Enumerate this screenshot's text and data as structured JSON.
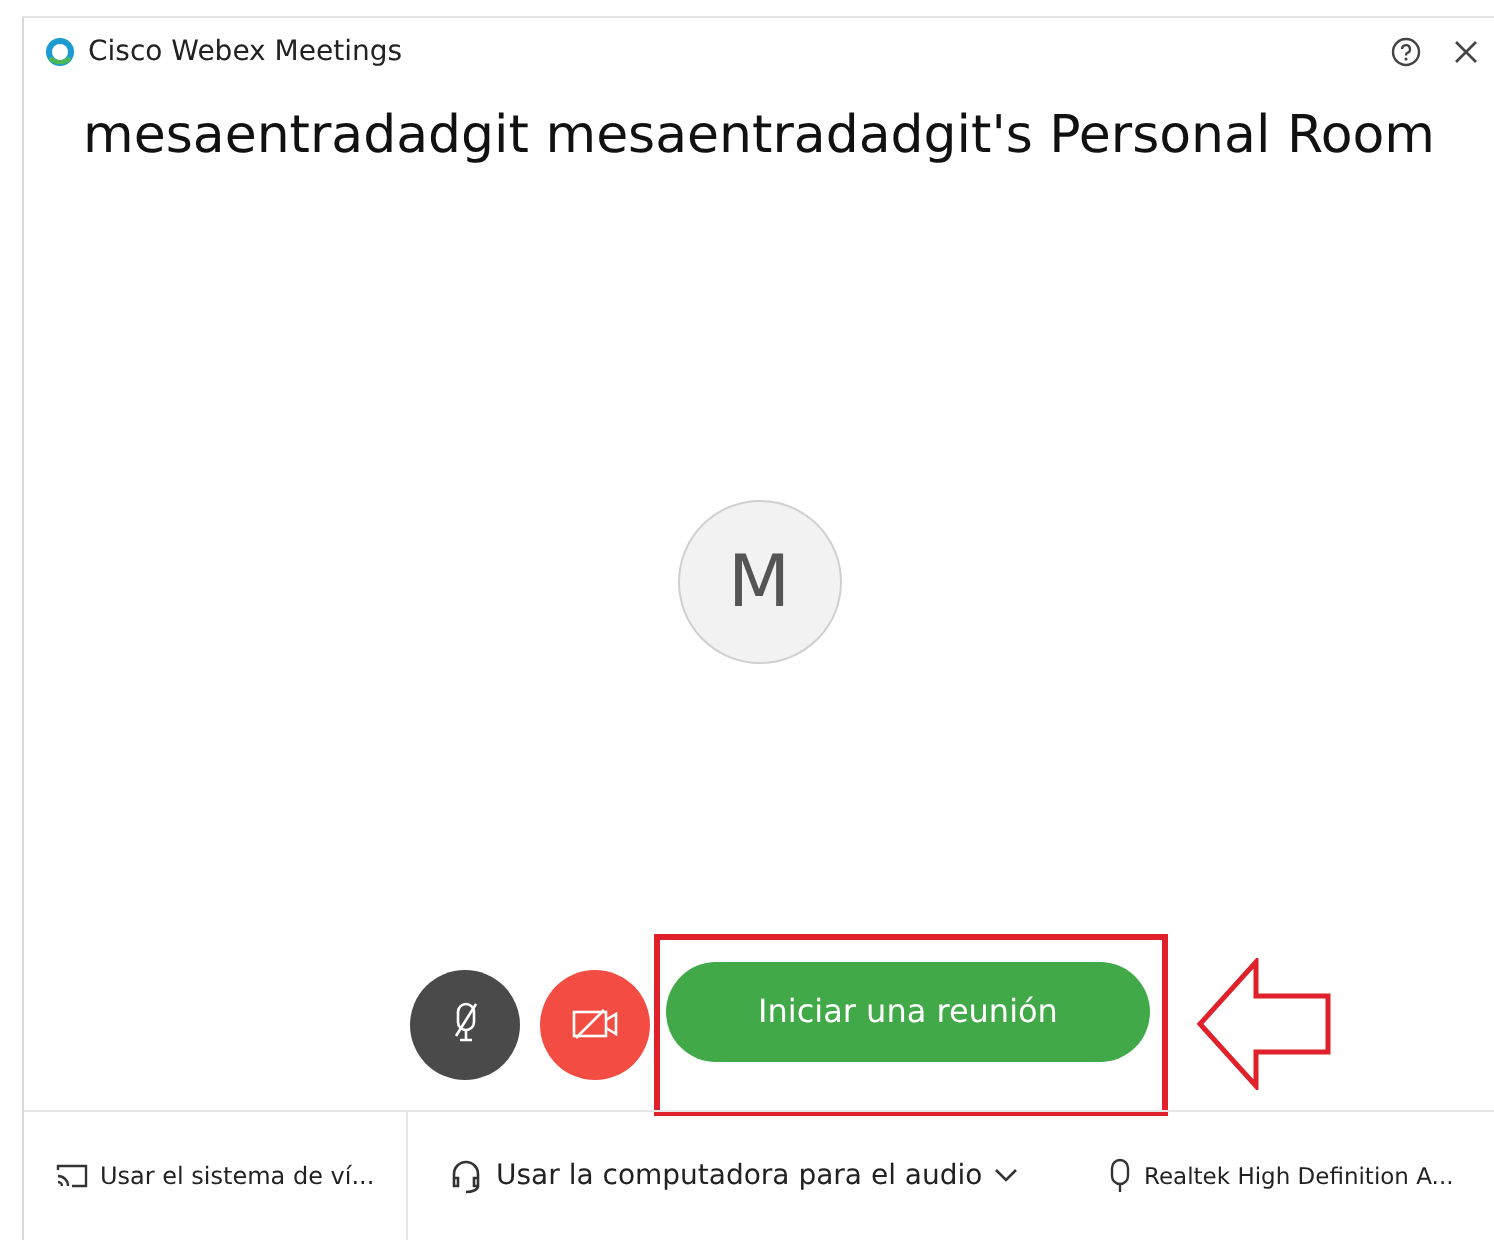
{
  "window": {
    "title": "Cisco Webex Meetings"
  },
  "room_title": "mesaentradadgit mesaentradadgit's Personal Room",
  "avatar": {
    "initial": "M"
  },
  "controls": {
    "mic": {
      "muted": true
    },
    "camera": {
      "off": true
    },
    "start_button": "Iniciar una reunión"
  },
  "bottom_bar": [
    {
      "kind": "video",
      "label": "Usar el sistema de ví..."
    },
    {
      "kind": "audio",
      "label": "Usar la computadora para el audio"
    },
    {
      "kind": "mic",
      "label": "Realtek High Definition A..."
    }
  ]
}
